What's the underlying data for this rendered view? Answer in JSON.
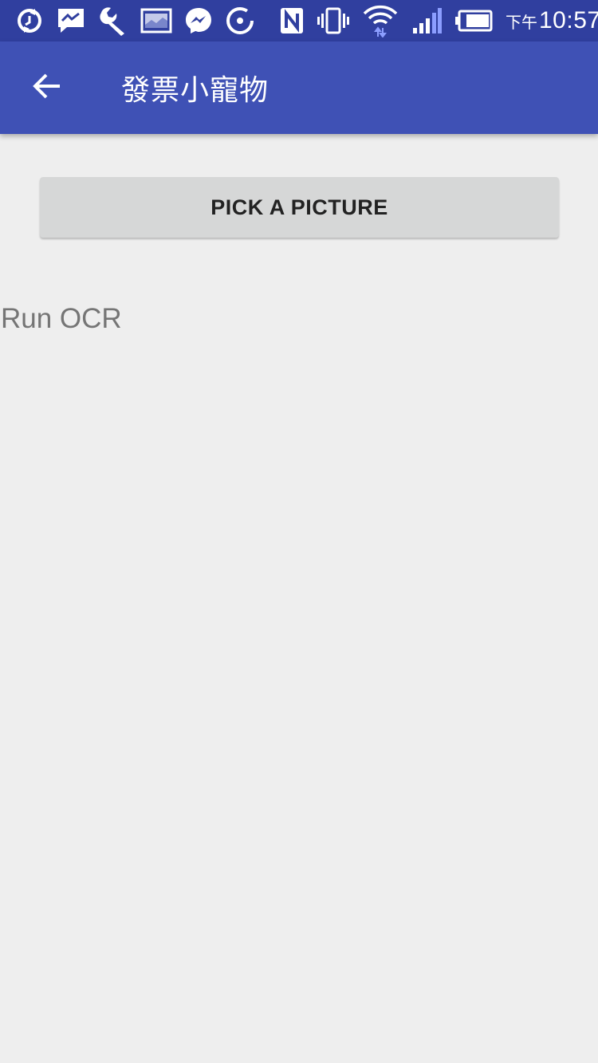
{
  "status_bar": {
    "left_icons": [
      "sync-icon",
      "hangouts-icon",
      "wrench-icon",
      "image-icon",
      "messenger-icon",
      "loading-ring-icon"
    ],
    "right_icons": [
      "nfc-icon",
      "vibrate-icon",
      "wifi-icon",
      "signal-icon",
      "battery-icon"
    ],
    "ampm": "下午",
    "time": "10:57",
    "background_color": "#303f9f"
  },
  "app_bar": {
    "back_icon": "arrow-back-icon",
    "title": "發票小寵物",
    "background_color": "#3f51b5"
  },
  "main": {
    "pick_button_label": "PICK A PICTURE",
    "ocr_label": "Run OCR"
  }
}
